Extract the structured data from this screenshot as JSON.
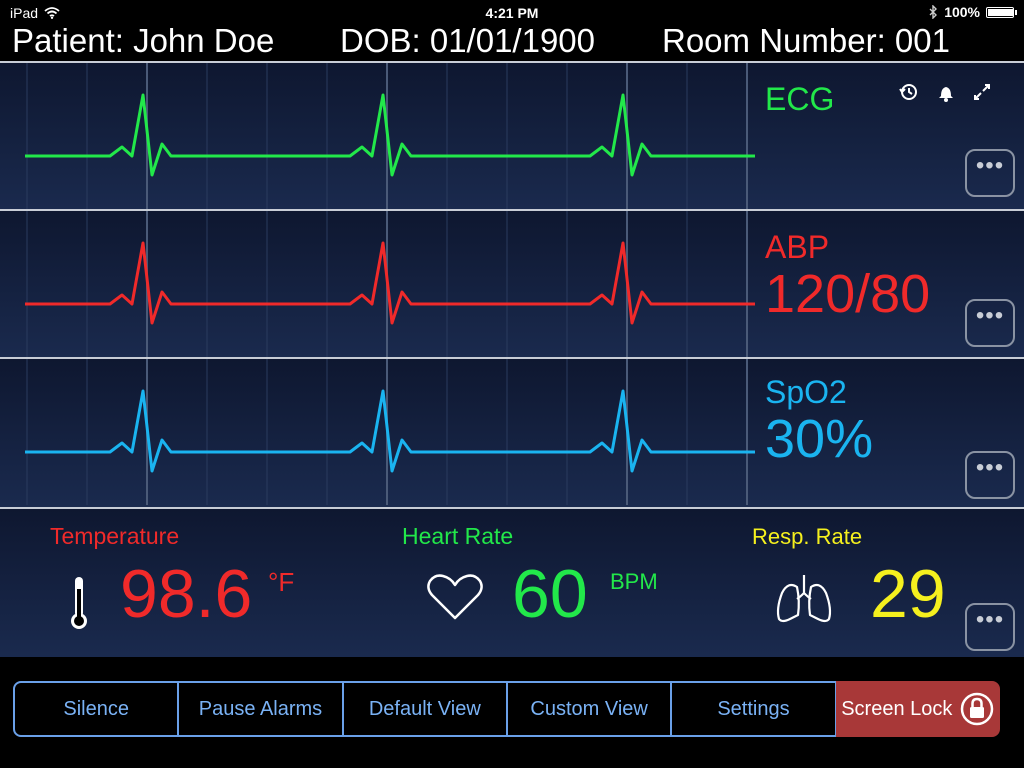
{
  "status_bar": {
    "device": "iPad",
    "time": "4:21 PM",
    "battery": "100%",
    "battery_level": 1.0
  },
  "header": {
    "patient": "Patient: John Doe",
    "dob": "DOB: 01/01/1900",
    "room": "Room Number: 001"
  },
  "waves": {
    "ecg": {
      "label": "ECG",
      "value": "",
      "color": "#22e84a"
    },
    "abp": {
      "label": "ABP",
      "value": "120/80",
      "color": "#f02a2a"
    },
    "spo2": {
      "label": "SpO2",
      "value": "30%",
      "color": "#1ab4f0"
    }
  },
  "icons": {
    "history": "history-icon",
    "alarm": "bell-icon",
    "expand": "expand-icon",
    "more": "more-icon"
  },
  "more_label": "•••",
  "vitals": {
    "temperature": {
      "label": "Temperature",
      "value": "98.6",
      "unit": "°F",
      "color": "#f02a2a",
      "icon": "thermometer-icon"
    },
    "heart_rate": {
      "label": "Heart Rate",
      "value": "60",
      "unit": "BPM",
      "color": "#22e84a",
      "icon": "heart-icon"
    },
    "resp_rate": {
      "label": "Resp. Rate",
      "value": "29",
      "unit": "",
      "color": "#f5f01e",
      "icon": "lungs-icon"
    }
  },
  "toolbar": {
    "silence": "Silence",
    "pause_alarms": "Pause Alarms",
    "default_view": "Default View",
    "custom_view": "Custom View",
    "settings": "Settings",
    "screen_lock": "Screen Lock"
  }
}
